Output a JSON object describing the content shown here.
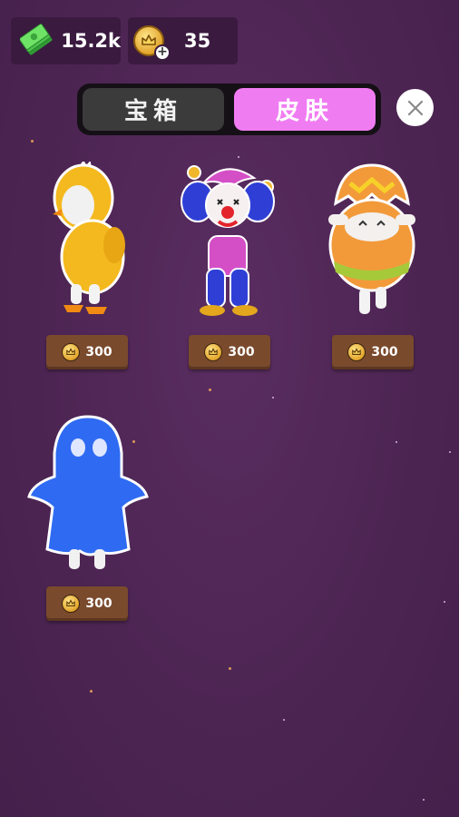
{
  "currencies": {
    "cash": {
      "value": "15.2k",
      "icon": "cash-stack-icon"
    },
    "crown": {
      "value": "35",
      "icon": "crown-coin-icon",
      "add_label": "+"
    }
  },
  "tabs": [
    {
      "label": "宝箱",
      "active": false
    },
    {
      "label": "皮肤",
      "active": true
    }
  ],
  "close_icon": "close-icon",
  "skins": [
    {
      "name": "chicken-costume",
      "price": "300",
      "color": "#f2b81c"
    },
    {
      "name": "jester-clown",
      "price": "300",
      "color": "#2e4ae0"
    },
    {
      "name": "easter-egg",
      "price": "300",
      "color": "#f29a3a"
    },
    {
      "name": "blue-ghost",
      "price": "300",
      "color": "#2f6bf2"
    }
  ],
  "colors": {
    "accent": "#f07cf2",
    "background": "#4d2553",
    "price_button": "#7a4a2d"
  }
}
